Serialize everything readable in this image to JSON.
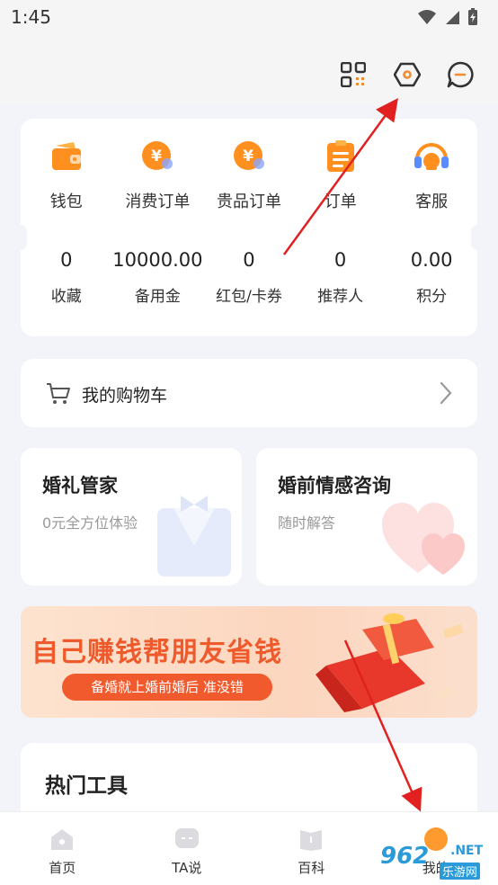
{
  "status_bar": {
    "time": "1:45"
  },
  "quick_actions": [
    {
      "label": "钱包",
      "icon": "wallet-icon"
    },
    {
      "label": "消费订单",
      "icon": "yuan-coin-icon"
    },
    {
      "label": "贵品订单",
      "icon": "yuan-coin-icon"
    },
    {
      "label": "订单",
      "icon": "order-list-icon"
    },
    {
      "label": "客服",
      "icon": "headset-icon"
    }
  ],
  "stats": [
    {
      "value": "0",
      "label": "收藏"
    },
    {
      "value": "10000.00",
      "label": "备用金"
    },
    {
      "value": "0",
      "label": "红包/卡券"
    },
    {
      "value": "0",
      "label": "推荐人"
    },
    {
      "value": "0.00",
      "label": "积分"
    }
  ],
  "cart": {
    "label": "我的购物车"
  },
  "features": [
    {
      "title": "婚礼管家",
      "subtitle": "0元全方位体验"
    },
    {
      "title": "婚前情感咨询",
      "subtitle": "随时解答"
    }
  ],
  "banner": {
    "title": "自己赚钱帮朋友省钱",
    "pill": "备婚就上婚前婚后 准没错"
  },
  "tools": {
    "title": "热门工具"
  },
  "tabs": [
    {
      "label": "首页",
      "icon": "home-icon"
    },
    {
      "label": "TA说",
      "icon": "chat-icon"
    },
    {
      "label": "百科",
      "icon": "book-icon"
    },
    {
      "label": "我的",
      "icon": "profile-icon"
    }
  ],
  "watermark": {
    "text": "962",
    "suffix": ".NET",
    "sub": "乐游网"
  },
  "colors": {
    "accent": "#f15a2c",
    "orange": "#ff9a2e",
    "annotation": "#e0211f"
  }
}
